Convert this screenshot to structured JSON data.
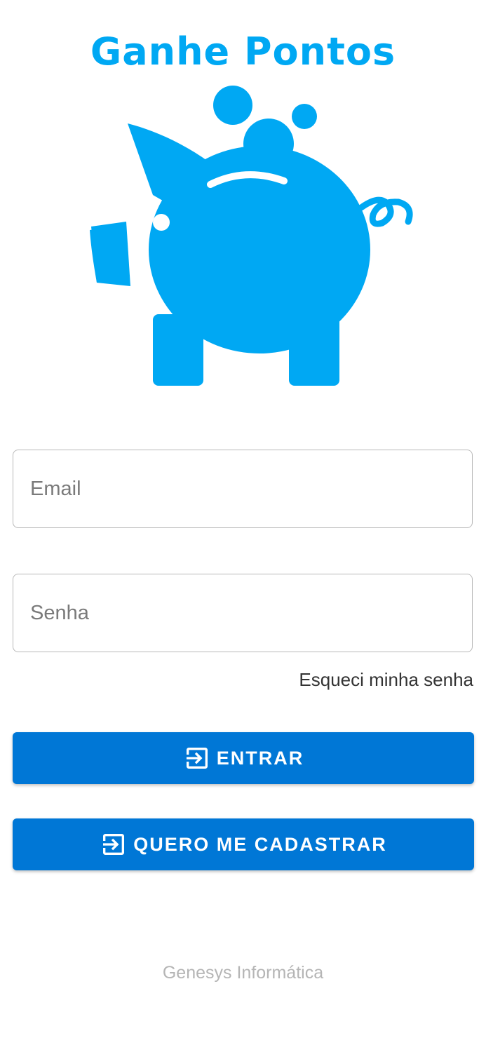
{
  "header": {
    "title": "Ganhe Pontos",
    "logo_icon": "piggy-bank-icon",
    "brand_color": "#00a8f3"
  },
  "form": {
    "email": {
      "placeholder": "Email",
      "value": ""
    },
    "password": {
      "placeholder": "Senha",
      "value": ""
    },
    "forgot_password_label": "Esqueci minha senha"
  },
  "actions": {
    "login_label": "ENTRAR",
    "login_icon": "login-icon",
    "register_label": "QUERO ME CADASTRAR",
    "register_icon": "login-icon",
    "button_color": "#0077d6"
  },
  "footer": {
    "text": "Genesys Informática"
  }
}
